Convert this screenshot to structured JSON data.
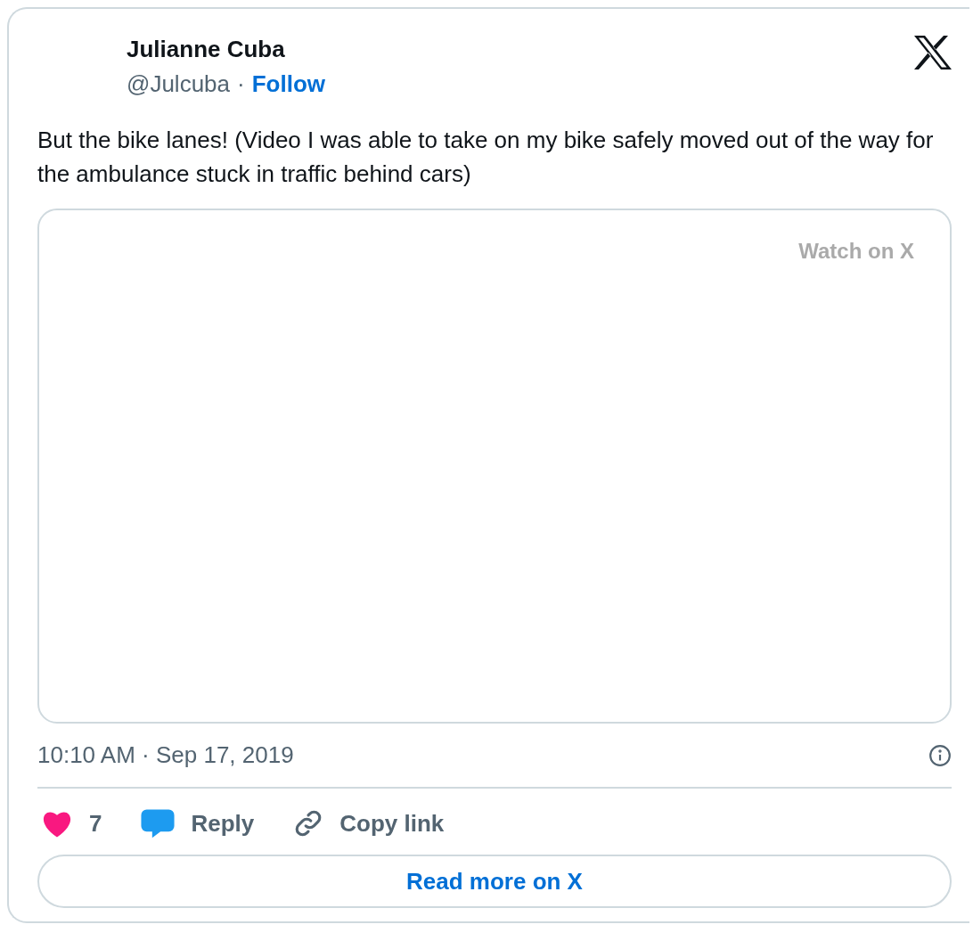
{
  "author": {
    "name": "Julianne Cuba",
    "handle": "@Julcuba",
    "separator": "·",
    "follow": "Follow"
  },
  "text": "But the bike lanes! (Video I was able to take on my bike safely moved out of the way for the ambulance stuck in traffic behind cars)",
  "media": {
    "kind": "video",
    "watch_label": "Watch on X"
  },
  "timestamp": "10:10 AM · Sep 17, 2019",
  "actions": [
    {
      "kind": "like",
      "label": "7"
    },
    {
      "kind": "reply",
      "label": "Reply"
    },
    {
      "kind": "copy",
      "label": "Copy link"
    }
  ],
  "read_more": "Read more on X"
}
